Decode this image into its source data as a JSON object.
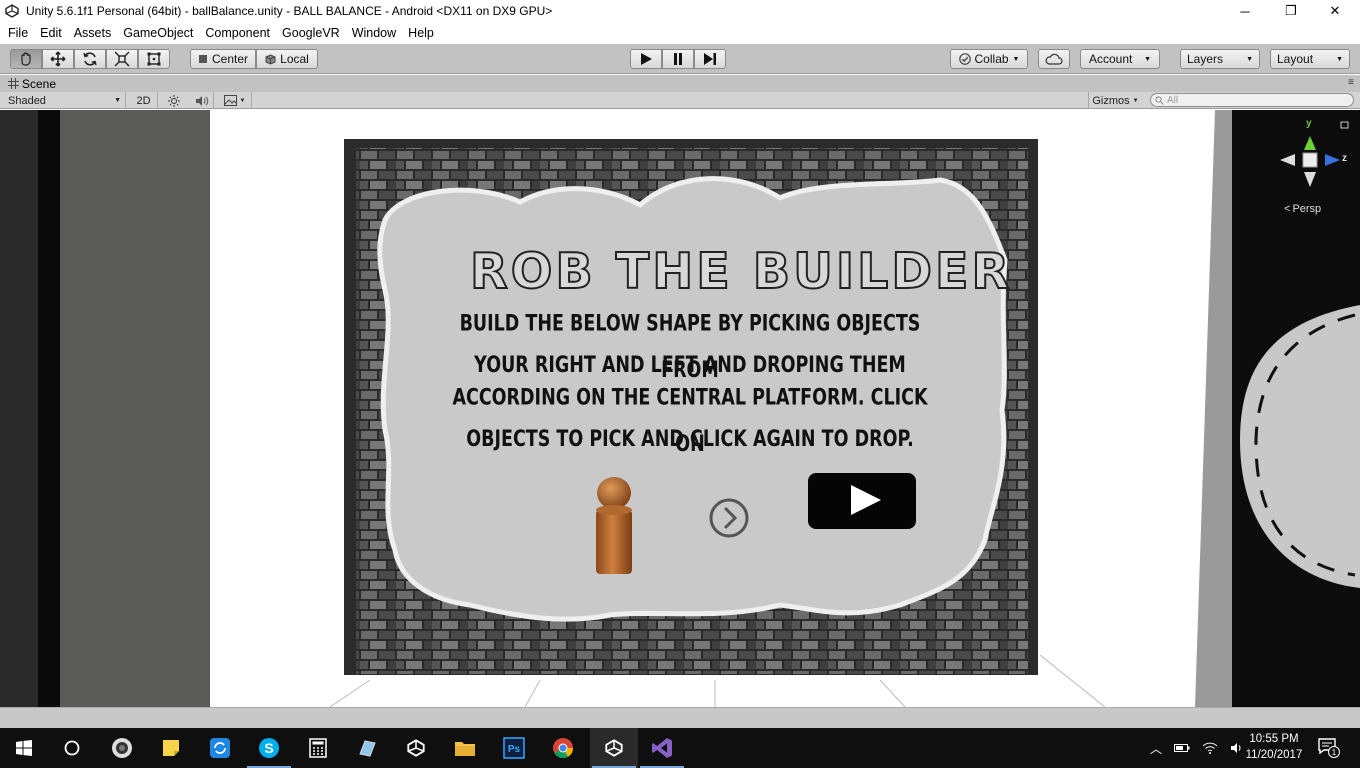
{
  "window": {
    "title": "Unity 5.6.1f1 Personal (64bit) - ballBalance.unity - BALL BALANCE - Android <DX11 on DX9 GPU>",
    "minimize": "─",
    "restore": "❐",
    "close": "✕"
  },
  "menu": [
    "File",
    "Edit",
    "Assets",
    "GameObject",
    "Component",
    "GoogleVR",
    "Window",
    "Help"
  ],
  "toolbar": {
    "center_label": "Center",
    "local_label": "Local",
    "collab_label": "Collab",
    "account_label": "Account",
    "layers_label": "Layers",
    "layout_label": "Layout"
  },
  "scene": {
    "tab_label": "Scene",
    "shading_mode": "Shaded",
    "mode_2d": "2D",
    "gizmos_label": "Gizmos",
    "search_placeholder": "All",
    "persp_label": "Persp",
    "axis_y": "y",
    "axis_z": "z"
  },
  "game": {
    "title": "ROB THE BUILDER",
    "instructions": [
      "BUILD THE BELOW SHAPE BY PICKING OBJECTS FROM",
      "YOUR RIGHT AND LEFT AND DROPING THEM",
      "ACCORDING ON THE CENTRAL PLATFORM. CLICK ON",
      "OBJECTS TO PICK AND CLICK AGAIN TO DROP."
    ]
  },
  "taskbar": {
    "time": "10:55 PM",
    "date": "11/20/2017",
    "notification_count": "1"
  },
  "colors": {
    "toolbar_bg": "#c2c2c2",
    "board_bg": "#c9c9c9",
    "taskbar_bg": "#0f0f0f",
    "gizmo_z": "#3b6fe0",
    "gizmo_y": "#6ecf3a"
  }
}
